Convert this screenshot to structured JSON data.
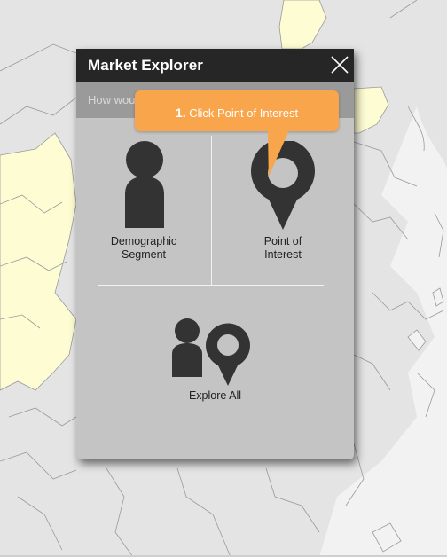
{
  "panel": {
    "title": "Market Explorer",
    "question": "How would you like to explore the market?"
  },
  "options": {
    "demographic": {
      "label": "Demographic\nSegment"
    },
    "poi": {
      "label": "Point of\nInterest"
    },
    "all": {
      "label": "Explore All"
    }
  },
  "callout": {
    "step": "1.",
    "text": "Click Point of Interest"
  },
  "colors": {
    "panel_header": "#262626",
    "panel_body": "#c4c4c4",
    "question_bar": "#9a9a9a",
    "callout": "#f8a54c",
    "map_land": "#e4e4e4",
    "map_highlight": "#fdfcd2",
    "map_border": "#9a9a9a"
  },
  "icons": {
    "close": "close-icon",
    "person": "person-icon",
    "map_pin": "map-pin-icon",
    "explore_all": "person-and-pin-icon"
  }
}
